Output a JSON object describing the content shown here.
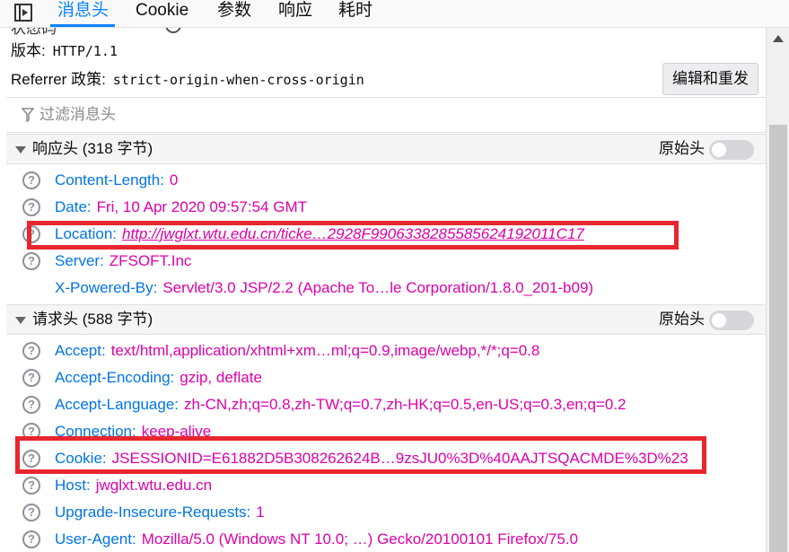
{
  "tabs": [
    "消息头",
    "Cookie",
    "参数",
    "响应",
    "耗时"
  ],
  "summary": {
    "status_label_partial": "状态码",
    "version_label": "版本:",
    "version_value": "HTTP/1.1",
    "referrer_label": "Referrer 政策:",
    "referrer_value": "strict-origin-when-cross-origin",
    "resend_button": "编辑和重发"
  },
  "filter_placeholder": "过滤消息头",
  "response_section": {
    "title": "响应头 (318 字节)",
    "raw_label": "原始头",
    "headers": [
      {
        "name": "Content-Length:",
        "value": "0",
        "help": true
      },
      {
        "name": "Date:",
        "value": "Fri, 10 Apr 2020 09:57:54 GMT",
        "help": true
      },
      {
        "name": "Location:",
        "value": "http://jwglxt.wtu.edu.cn/ticke…2928F9906338285585624192011C17",
        "help": true,
        "link": true
      },
      {
        "name": "Server:",
        "value": "ZFSOFT.Inc",
        "help": true
      },
      {
        "name": "X-Powered-By:",
        "value": "Servlet/3.0 JSP/2.2 (Apache To…le Corporation/1.8.0_201-b09)",
        "help": false
      }
    ]
  },
  "request_section": {
    "title": "请求头 (588 字节)",
    "raw_label": "原始头",
    "headers": [
      {
        "name": "Accept:",
        "value": "text/html,application/xhtml+xm…ml;q=0.9,image/webp,*/*;q=0.8",
        "help": true
      },
      {
        "name": "Accept-Encoding:",
        "value": "gzip, deflate",
        "help": true
      },
      {
        "name": "Accept-Language:",
        "value": "zh-CN,zh;q=0.8,zh-TW;q=0.7,zh-HK;q=0.5,en-US;q=0.3,en;q=0.2",
        "help": true
      },
      {
        "name": "Connection:",
        "value": "keep-alive",
        "help": true
      },
      {
        "name": "Cookie:",
        "value": "JSESSIONID=E61882D5B308262624B…9zsJU0%3D%40AAJTSQACMDE%3D%23",
        "help": true
      },
      {
        "name": "Host:",
        "value": "jwglxt.wtu.edu.cn",
        "help": true
      },
      {
        "name": "Upgrade-Insecure-Requests:",
        "value": "1",
        "help": true
      },
      {
        "name": "User-Agent:",
        "value": "Mozilla/5.0 (Windows NT 10.0; …) Gecko/20100101 Firefox/75.0",
        "help": true
      }
    ]
  },
  "colors": {
    "header_name": "#0074e8",
    "header_value": "#dd00a9",
    "active_tab": "#0a84ff",
    "highlight_box": "#e8262e"
  }
}
